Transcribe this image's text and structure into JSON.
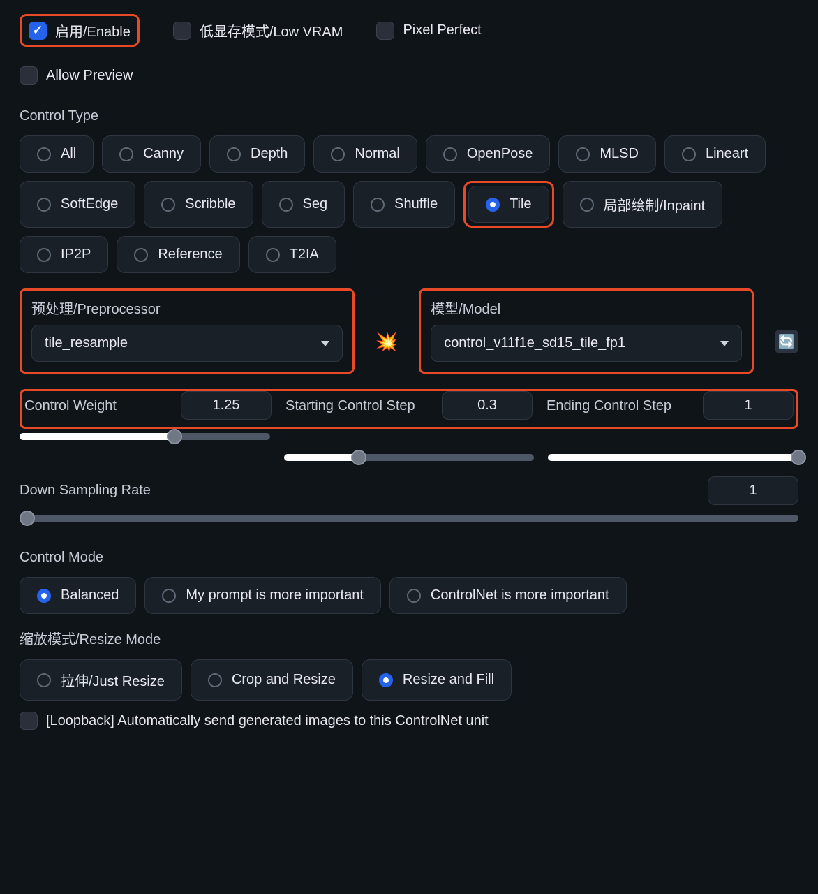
{
  "checks": {
    "enable": "启用/Enable",
    "low_vram": "低显存模式/Low VRAM",
    "pixel_perfect": "Pixel Perfect",
    "allow_preview": "Allow Preview",
    "loopback": "[Loopback] Automatically send generated images to this ControlNet unit"
  },
  "control_type": {
    "label": "Control Type",
    "options": [
      "All",
      "Canny",
      "Depth",
      "Normal",
      "OpenPose",
      "MLSD",
      "Lineart",
      "SoftEdge",
      "Scribble",
      "Seg",
      "Shuffle",
      "Tile",
      "局部绘制/Inpaint",
      "IP2P",
      "Reference",
      "T2IA"
    ],
    "selected": "Tile"
  },
  "preprocessor": {
    "label": "预处理/Preprocessor",
    "value": "tile_resample"
  },
  "model": {
    "label": "模型/Model",
    "value": "control_v11f1e_sd15_tile_fp1"
  },
  "sliders": {
    "weight": {
      "label": "Control Weight",
      "value": "1.25",
      "pct": 62
    },
    "start": {
      "label": "Starting Control Step",
      "value": "0.3",
      "pct": 30
    },
    "end": {
      "label": "Ending Control Step",
      "value": "1",
      "pct": 100
    },
    "down": {
      "label": "Down Sampling Rate",
      "value": "1",
      "pct": 0
    }
  },
  "control_mode": {
    "label": "Control Mode",
    "options": [
      "Balanced",
      "My prompt is more important",
      "ControlNet is more important"
    ],
    "selected": "Balanced"
  },
  "resize_mode": {
    "label": "缩放模式/Resize Mode",
    "options": [
      "拉伸/Just Resize",
      "Crop and Resize",
      "Resize and Fill"
    ],
    "selected": "Resize and Fill"
  }
}
